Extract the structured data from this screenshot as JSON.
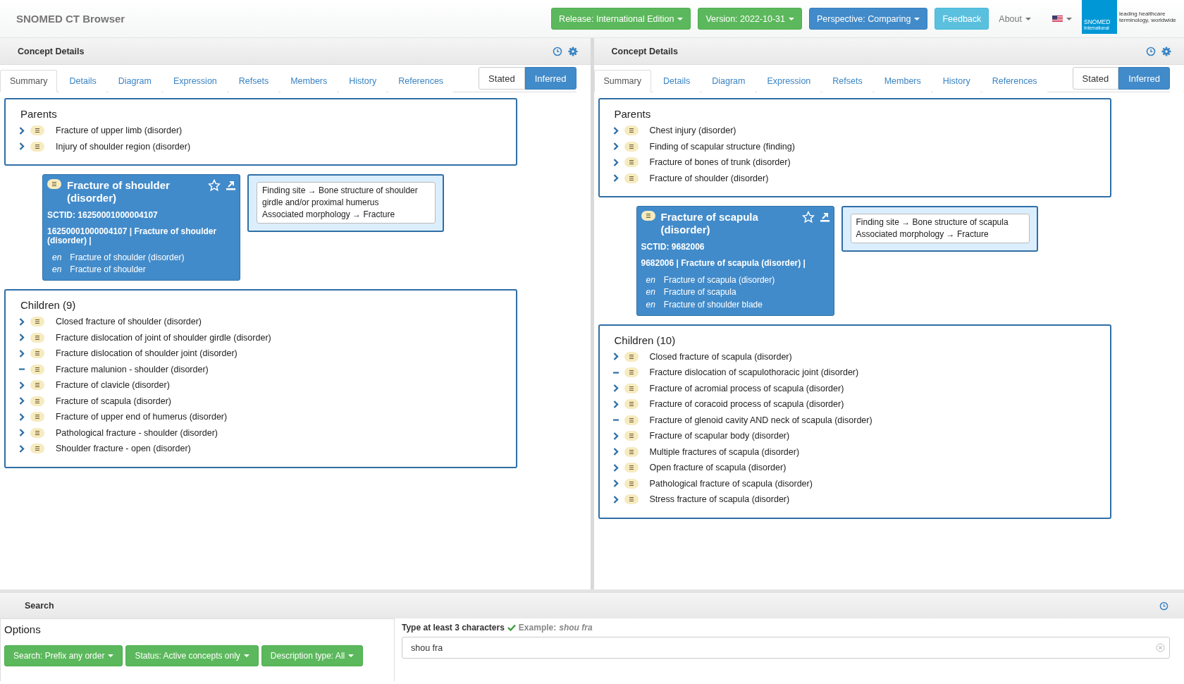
{
  "header": {
    "title": "SNOMED CT Browser",
    "menus": [
      {
        "label": "Release: International Edition",
        "kind": "success",
        "dropdown": true
      },
      {
        "label": "Version: 2022-10-31",
        "kind": "success",
        "dropdown": true
      },
      {
        "label": "Perspective: Comparing",
        "kind": "primary",
        "dropdown": true
      },
      {
        "label": "Feedback",
        "kind": "info",
        "dropdown": false
      }
    ],
    "about": "About",
    "logo": {
      "name": "SNOMED",
      "sub": "International",
      "tagline": "leading healthcare terminology, worldwide"
    }
  },
  "panels": [
    {
      "title": "Concept Details",
      "tabs": [
        {
          "label": "Summary",
          "selected": true
        },
        {
          "label": "Details",
          "selected": false
        },
        {
          "label": "Diagram",
          "selected": false
        },
        {
          "label": "Expression",
          "selected": false
        },
        {
          "label": "Refsets",
          "selected": false
        },
        {
          "label": "Members",
          "selected": false
        },
        {
          "label": "History",
          "selected": false
        },
        {
          "label": "References",
          "selected": false
        }
      ],
      "views": [
        {
          "label": "Stated",
          "selected": false
        },
        {
          "label": "Inferred",
          "selected": true
        }
      ],
      "parents": {
        "title": "Parents",
        "items": [
          {
            "label": "Fracture of upper limb (disorder)",
            "kind": "expandable"
          },
          {
            "label": "Injury of shoulder region (disorder)",
            "kind": "expandable"
          }
        ]
      },
      "concept": {
        "title": "Fracture of shoulder (disorder)",
        "sctid": "SCTID: 16250001000004107",
        "expression": "16250001000004107 | Fracture of shoulder (disorder) |",
        "descriptions": [
          {
            "lang": "en",
            "term": "Fracture of shoulder (disorder)"
          },
          {
            "lang": "en",
            "term": "Fracture of shoulder"
          }
        ]
      },
      "attributes": [
        "Finding site →  Bone structure of shoulder girdle and/or proximal humerus",
        "Associated morphology →  Fracture"
      ],
      "children": {
        "title": "Children (9)",
        "items": [
          {
            "label": "Closed fracture of shoulder (disorder)",
            "kind": "expandable"
          },
          {
            "label": "Fracture dislocation of joint of shoulder girdle (disorder)",
            "kind": "expandable"
          },
          {
            "label": "Fracture dislocation of shoulder joint (disorder)",
            "kind": "expandable"
          },
          {
            "label": "Fracture malunion - shoulder (disorder)",
            "kind": "leaf"
          },
          {
            "label": "Fracture of clavicle (disorder)",
            "kind": "expandable"
          },
          {
            "label": "Fracture of scapula (disorder)",
            "kind": "expandable"
          },
          {
            "label": "Fracture of upper end of humerus (disorder)",
            "kind": "expandable"
          },
          {
            "label": "Pathological fracture - shoulder (disorder)",
            "kind": "expandable"
          },
          {
            "label": "Shoulder fracture - open (disorder)",
            "kind": "expandable"
          }
        ]
      }
    },
    {
      "title": "Concept Details",
      "tabs": [
        {
          "label": "Summary",
          "selected": true
        },
        {
          "label": "Details",
          "selected": false
        },
        {
          "label": "Diagram",
          "selected": false
        },
        {
          "label": "Expression",
          "selected": false
        },
        {
          "label": "Refsets",
          "selected": false
        },
        {
          "label": "Members",
          "selected": false
        },
        {
          "label": "History",
          "selected": false
        },
        {
          "label": "References",
          "selected": false
        }
      ],
      "views": [
        {
          "label": "Stated",
          "selected": false
        },
        {
          "label": "Inferred",
          "selected": true
        }
      ],
      "parents": {
        "title": "Parents",
        "items": [
          {
            "label": "Chest injury (disorder)",
            "kind": "expandable"
          },
          {
            "label": "Finding of scapular structure (finding)",
            "kind": "expandable"
          },
          {
            "label": "Fracture of bones of trunk (disorder)",
            "kind": "expandable"
          },
          {
            "label": "Fracture of shoulder (disorder)",
            "kind": "expandable"
          }
        ]
      },
      "concept": {
        "title": "Fracture of scapula (disorder)",
        "sctid": "SCTID: 9682006",
        "expression": "9682006 | Fracture of scapula (disorder) |",
        "descriptions": [
          {
            "lang": "en",
            "term": "Fracture of scapula (disorder)"
          },
          {
            "lang": "en",
            "term": "Fracture of scapula"
          },
          {
            "lang": "en",
            "term": "Fracture of shoulder blade"
          }
        ]
      },
      "attributes": [
        "Finding site →  Bone structure of scapula",
        "Associated morphology →  Fracture"
      ],
      "children": {
        "title": "Children (10)",
        "items": [
          {
            "label": "Closed fracture of scapula (disorder)",
            "kind": "expandable"
          },
          {
            "label": "Fracture dislocation of scapulothoracic joint (disorder)",
            "kind": "leaf"
          },
          {
            "label": "Fracture of acromial process of scapula (disorder)",
            "kind": "expandable"
          },
          {
            "label": "Fracture of coracoid process of scapula (disorder)",
            "kind": "expandable"
          },
          {
            "label": "Fracture of glenoid cavity AND neck of scapula (disorder)",
            "kind": "leaf"
          },
          {
            "label": "Fracture of scapular body (disorder)",
            "kind": "expandable"
          },
          {
            "label": "Multiple fractures of scapula (disorder)",
            "kind": "expandable"
          },
          {
            "label": "Open fracture of scapula (disorder)",
            "kind": "expandable"
          },
          {
            "label": "Pathological fracture of scapula (disorder)",
            "kind": "expandable"
          },
          {
            "label": "Stress fracture of scapula (disorder)",
            "kind": "expandable"
          }
        ]
      }
    }
  ],
  "search": {
    "title": "Search",
    "options_title": "Options",
    "filters": [
      "Search: Prefix any order",
      "Status: Active concepts only",
      "Description type: All"
    ],
    "hint": "Type at least 3 characters",
    "example_label": "Example:",
    "example": "shou fra",
    "value": "shou fra"
  }
}
